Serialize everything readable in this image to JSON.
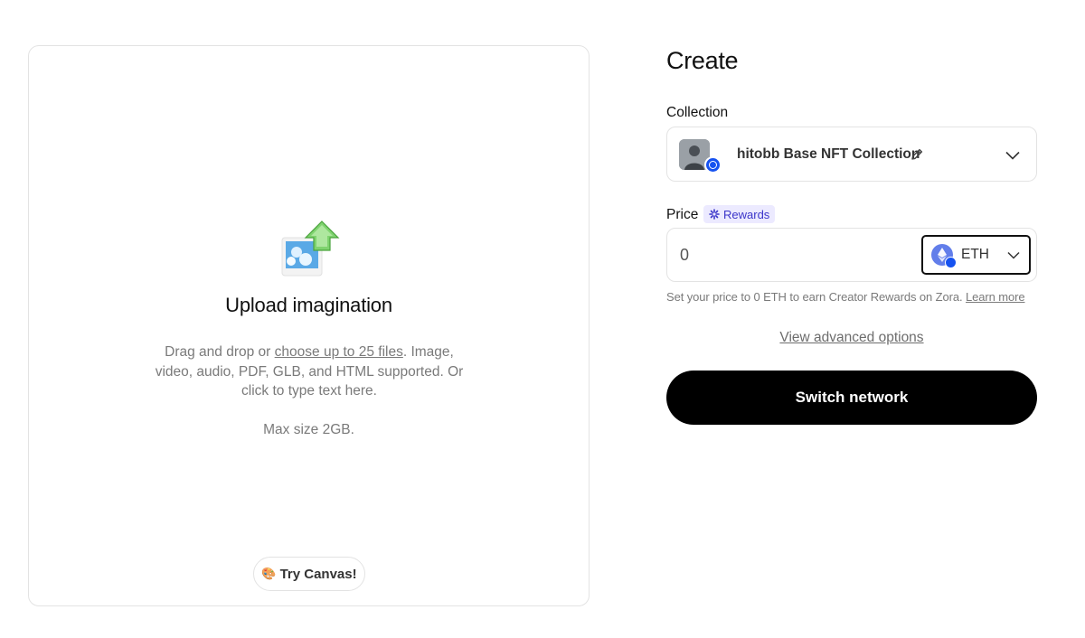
{
  "upload": {
    "title": "Upload imagination",
    "desc_prefix": "Drag and drop or ",
    "desc_link": "choose up to 25 files",
    "desc_suffix": ". Image, video, audio, PDF, GLB, and HTML supported. Or click to type text here.",
    "max_size": "Max size 2GB.",
    "try_canvas_emoji": "🎨",
    "try_canvas_label": "Try Canvas!",
    "art_icon": "image-upload-icon"
  },
  "create": {
    "title": "Create",
    "collection_label": "Collection",
    "collection_name": "hitobb Base NFT Collection",
    "collection_icons": [
      "avatar",
      "base-network-badge",
      "pencil-icon",
      "chevron-down-icon"
    ],
    "price_label": "Price",
    "rewards_label": "Rewards",
    "price_value": "0",
    "currency": "ETH",
    "currency_icon": "eth-icon",
    "price_hint": "Set your price to 0 ETH to earn Creator Rewards on Zora. ",
    "price_hint_link": "Learn more",
    "advanced_link": "View advanced options",
    "switch_button": "Switch network"
  },
  "colors": {
    "primary_button_bg": "#000000",
    "rewards_badge_bg": "#eceaff",
    "rewards_badge_text": "#3b35c9",
    "base_blue": "#1652f0",
    "eth_purple": "#627eea",
    "border": "#e3e3e3",
    "muted_text": "#7a7a7a"
  }
}
